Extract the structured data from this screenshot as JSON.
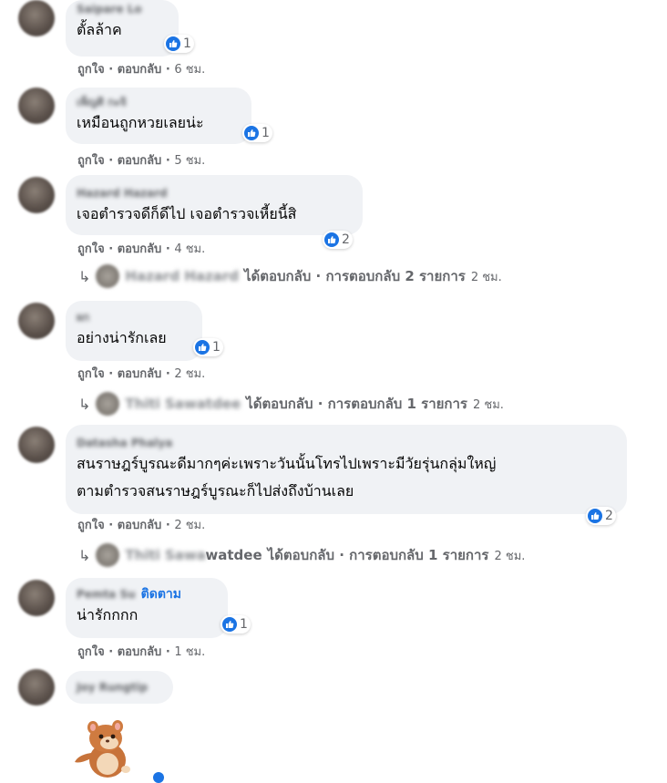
{
  "actions": {
    "like": "ถูกใจ",
    "reply": "ตอบกลับ",
    "sep": "·"
  },
  "comments": [
    {
      "name": "Saipare Lo",
      "text": "ตั้ลล้าค",
      "reactions": "1",
      "time": "6 ชม."
    },
    {
      "name": "เพ็ญศิ กะจิ",
      "text": "เหมือนถูกหวยเลยน่ะ",
      "reactions": "1",
      "time": "5 ชม."
    },
    {
      "name": "Hazard Hazard",
      "text": "เจอตำรวจดีก็ดีไป เจอตำรวจเหี้ยนี้สิ",
      "reactions": "2",
      "time": "4 ชม.",
      "reply_summary": {
        "name": "Hazard Hazard",
        "label": "ได้ตอบกลับ · การตอบกลับ 2 รายการ",
        "time": "2 ชม."
      }
    },
    {
      "name": "ผก",
      "text": "อย่างน่ารักเลย",
      "reactions": "1",
      "time": "2 ชม.",
      "reply_summary": {
        "name": "Thiti Sawatdee",
        "label": "ได้ตอบกลับ · การตอบกลับ 1 รายการ",
        "time": "2 ชม."
      }
    },
    {
      "name": "Datasha Phalya",
      "text_lines": [
        "สนราษฎร์บูรณะดีมากๆค่ะเพราะวันนั้นโทรไปเพราะมีวัยรุ่นกลุ่มใหญ่",
        "ตามตำรวจสนราษฎร์บูรณะก็ไปส่งถึงบ้านเลย"
      ],
      "reactions": "2",
      "time": "2 ชม.",
      "reply_summary": {
        "name": "Thiti Sawatdee",
        "name_visible": "watdee",
        "label": "ได้ตอบกลับ · การตอบกลับ 1 รายการ",
        "time": "2 ชม."
      }
    },
    {
      "name": "Pemta Su",
      "follow": "ติดตาม",
      "text": "น่ารักกกก",
      "reactions": "1",
      "time": "1 ชม."
    },
    {
      "name": "Joy Rungtip"
    }
  ],
  "icons": {
    "like": "thumbs-up-icon",
    "reply_arrow": "reply-arrow-icon"
  },
  "colors": {
    "bubble": "#f0f2f5",
    "like_blue": "#1b74e4",
    "meta": "#65676b"
  }
}
